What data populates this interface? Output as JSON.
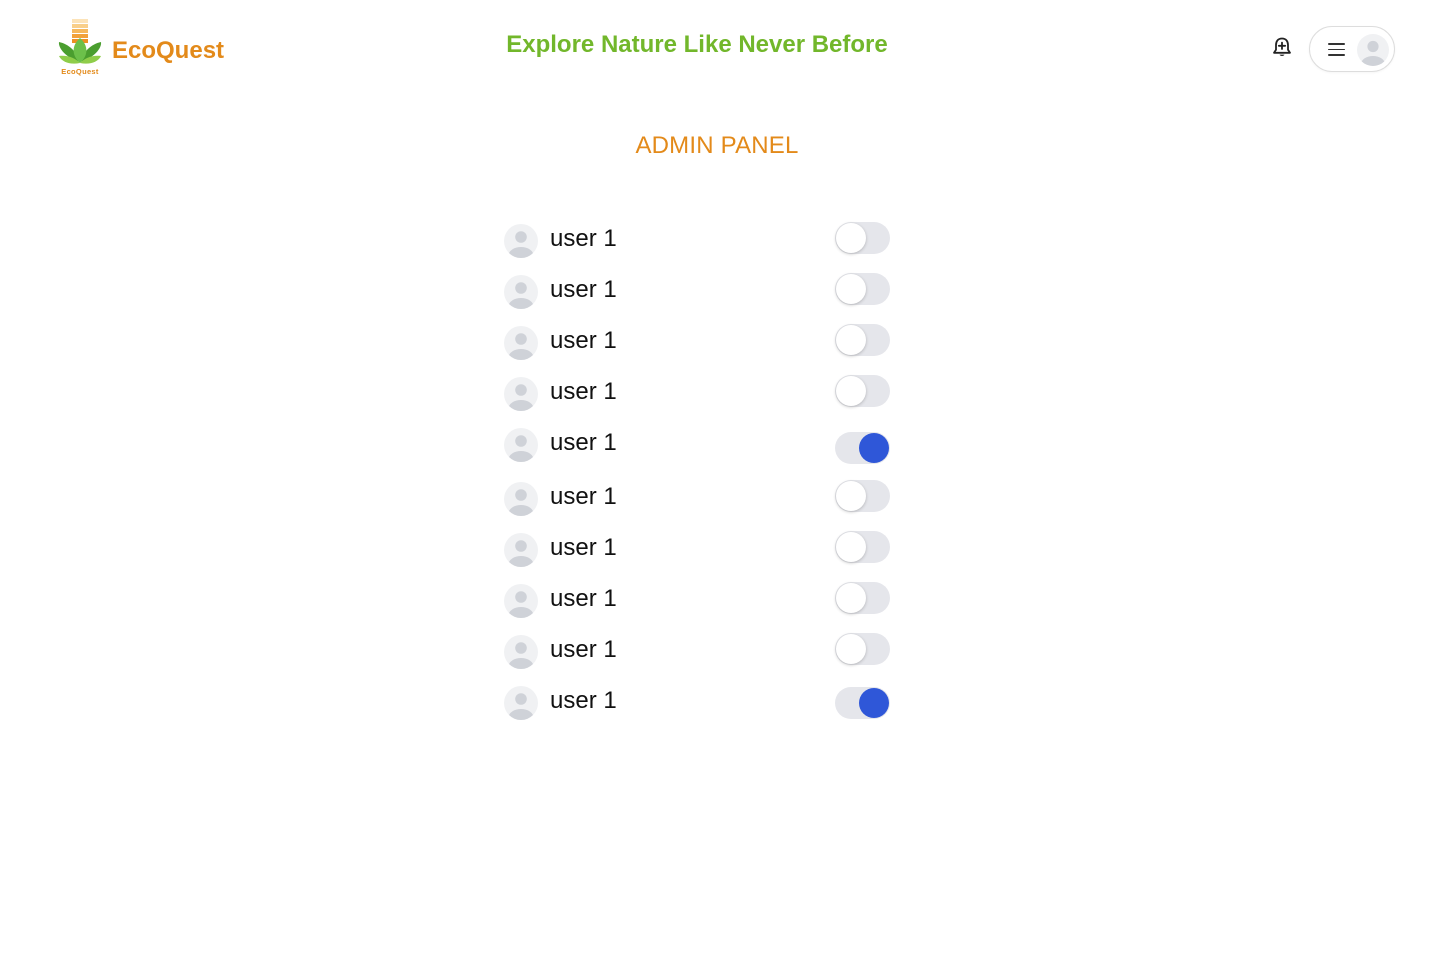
{
  "header": {
    "brand_name": "EcoQuest",
    "logo_caption": "EcoQuest",
    "tagline": "Explore Nature Like Never Before",
    "notification_icon": "bell-plus-icon",
    "menu_icon": "hamburger-menu-icon",
    "avatar_icon": "user-avatar-icon"
  },
  "main": {
    "title": "ADMIN PANEL",
    "users": [
      {
        "name": "user 1",
        "enabled": false
      },
      {
        "name": "user 1",
        "enabled": false
      },
      {
        "name": "user 1",
        "enabled": false
      },
      {
        "name": "user 1",
        "enabled": false
      },
      {
        "name": "user 1",
        "enabled": true
      },
      {
        "name": "user 1",
        "enabled": false
      },
      {
        "name": "user 1",
        "enabled": false
      },
      {
        "name": "user 1",
        "enabled": false
      },
      {
        "name": "user 1",
        "enabled": false
      },
      {
        "name": "user 1",
        "enabled": true
      }
    ]
  },
  "colors": {
    "brand_orange": "#e38a1a",
    "tagline_green": "#72b72b",
    "toggle_on": "#2f57d8",
    "toggle_track": "#e5e6eb"
  }
}
